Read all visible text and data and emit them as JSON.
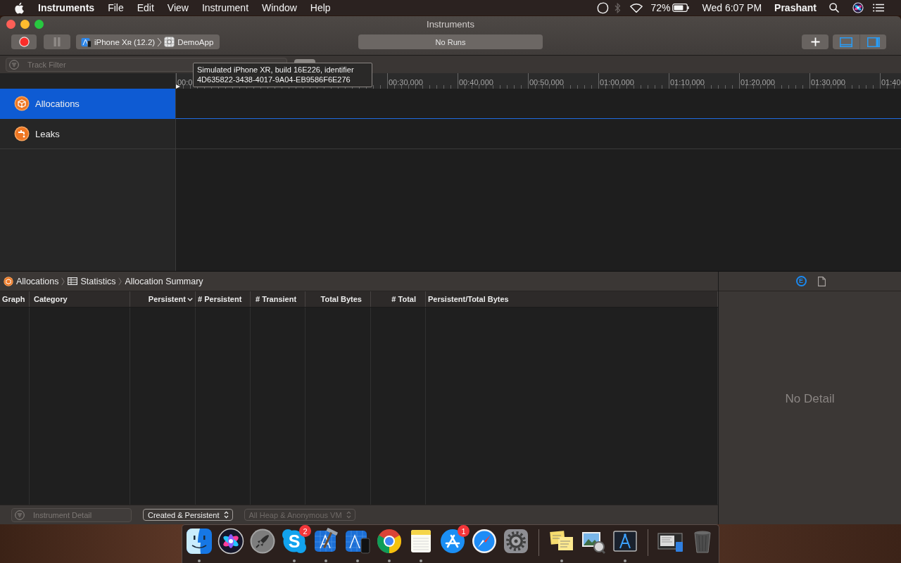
{
  "menu_bar": {
    "app_name": "Instruments",
    "menus": [
      "File",
      "Edit",
      "View",
      "Instrument",
      "Window",
      "Help"
    ],
    "bluetooth_on": false,
    "battery": "72%",
    "clock": "Wed 6:07 PM",
    "user": "Prashant"
  },
  "window": {
    "title": "Instruments"
  },
  "toolbar": {
    "pause_disabled": true,
    "device": "iPhone Xʀ (12.2)",
    "app": "DemoApp",
    "status": "No Runs",
    "view_toggles": [
      {
        "kind": "bottom_panel",
        "selected": true
      },
      {
        "kind": "side_panel",
        "selected": true
      }
    ]
  },
  "track_filter": {
    "placeholder": "Track Filter"
  },
  "tooltip": {
    "lines": [
      "Simulated iPhone XR, build 16E226, identifier",
      "4D635822-3438-4017-9A04-EB9586F6E276"
    ]
  },
  "timeline": {
    "labels": [
      "00:0",
      "00:30.000",
      "00:40.000",
      "00:50.000",
      "01:00.000",
      "01:10.000",
      "01:20.000",
      "01:30.000",
      "01:40"
    ]
  },
  "tracks": [
    {
      "kind": "allocations",
      "name": "Allocations",
      "selected": true
    },
    {
      "kind": "leaks",
      "name": "Leaks",
      "selected": false
    }
  ],
  "detail": {
    "breadcrumb": [
      {
        "kind": "instrument",
        "label": "Allocations"
      },
      {
        "kind": "view",
        "label": "Statistics"
      },
      {
        "kind": "text",
        "label": "Allocation Summary"
      }
    ],
    "columns": [
      {
        "label": "Graph",
        "sorted": false
      },
      {
        "label": "Category",
        "sorted": false
      },
      {
        "label": "Persistent",
        "sorted": true
      },
      {
        "label": "# Persistent",
        "sorted": false
      },
      {
        "label": "# Transient",
        "sorted": false
      },
      {
        "label": "Total Bytes",
        "sorted": false
      },
      {
        "label": "# Total",
        "sorted": false
      },
      {
        "label": "Persistent/Total Bytes",
        "sorted": false
      }
    ],
    "filter_placeholder": "Instrument Detail",
    "popups": [
      {
        "value": "Created & Persistent",
        "disabled": false
      },
      {
        "value": "All Heap & Anonymous VM",
        "disabled": true
      }
    ]
  },
  "inspector": {
    "tabs": [
      {
        "kind": "extended",
        "glyph": "E",
        "selected": true
      },
      {
        "kind": "document",
        "selected": false
      }
    ],
    "empty_text": "No Detail"
  },
  "dock": {
    "sections": [
      {
        "items": [
          {
            "kind": "finder",
            "running": true
          },
          {
            "kind": "siri",
            "running": false
          },
          {
            "kind": "launchpad",
            "running": false
          },
          {
            "kind": "skype",
            "glyph": "S",
            "badge": "2",
            "running": true
          },
          {
            "kind": "xcode",
            "running": true
          },
          {
            "kind": "simulator",
            "running": true
          },
          {
            "kind": "chrome",
            "running": true
          },
          {
            "kind": "notes",
            "running": true
          },
          {
            "kind": "appstore",
            "badge": "1",
            "running": false
          },
          {
            "kind": "safari",
            "running": false
          },
          {
            "kind": "settings",
            "running": false
          }
        ]
      },
      {
        "items": [
          {
            "kind": "stickies",
            "running": true
          },
          {
            "kind": "preview",
            "running": false
          },
          {
            "kind": "instruments",
            "running": true
          }
        ]
      },
      {
        "items": [
          {
            "kind": "window",
            "running": false
          },
          {
            "kind": "trash",
            "running": false
          }
        ]
      }
    ]
  }
}
